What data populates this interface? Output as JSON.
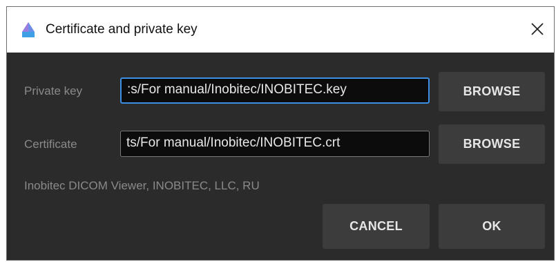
{
  "window": {
    "title": "Certificate and private key",
    "close_icon": "close-icon",
    "app_icon": "inobitec-logo-icon"
  },
  "form": {
    "private_key_label": "Private key",
    "private_key_value": ":s/For manual/Inobitec/INOBITEC.key",
    "certificate_label": "Certificate",
    "certificate_value": "ts/For manual/Inobitec/INOBITEC.crt",
    "browse_label": "BROWSE",
    "info": "Inobitec DICOM Viewer, INOBITEC, LLC, RU"
  },
  "actions": {
    "cancel_label": "CANCEL",
    "ok_label": "OK"
  },
  "colors": {
    "dialog_bg": "#2b2b2b",
    "button_bg": "#3c3c3c",
    "focus_border": "#3d8fe6",
    "field_bg": "#0c0c0c"
  }
}
